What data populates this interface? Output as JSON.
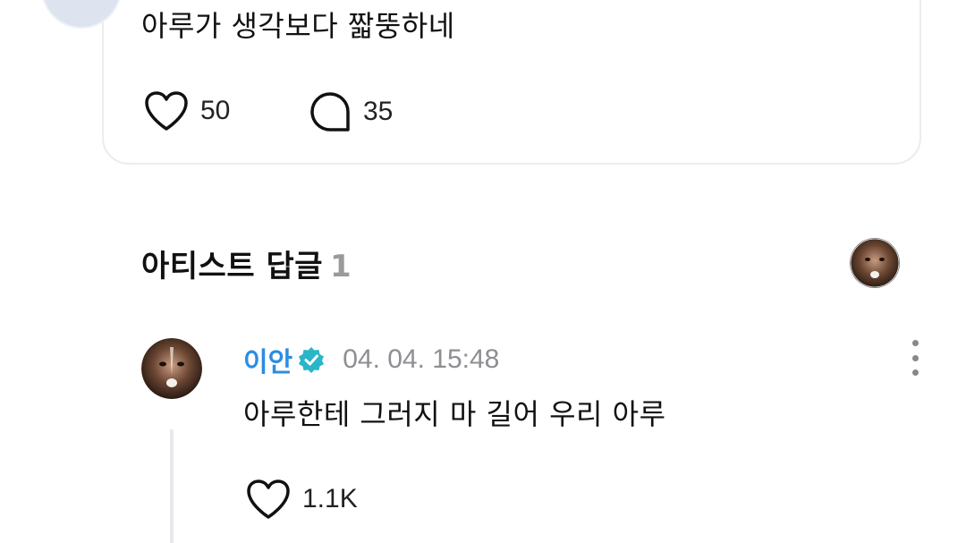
{
  "post": {
    "text": "아루가 생각보다 짧뚱하네",
    "like_count": "50",
    "comment_count": "35"
  },
  "artist_replies": {
    "title": "아티스트 답글",
    "count": "1"
  },
  "reply": {
    "author": "이안",
    "timestamp": "04. 04. 15:48",
    "text": "아루한테 그러지 마 길어 우리 아루",
    "like_count": "1.1K"
  },
  "colors": {
    "author_blue": "#2b8de3",
    "verified_teal": "#2bb5c8",
    "muted_gray": "#8e8e93",
    "card_border": "#ececef"
  },
  "icons": [
    "heart-icon",
    "comment-bubble-icon",
    "verified-badge-icon",
    "more-vertical-icon"
  ]
}
